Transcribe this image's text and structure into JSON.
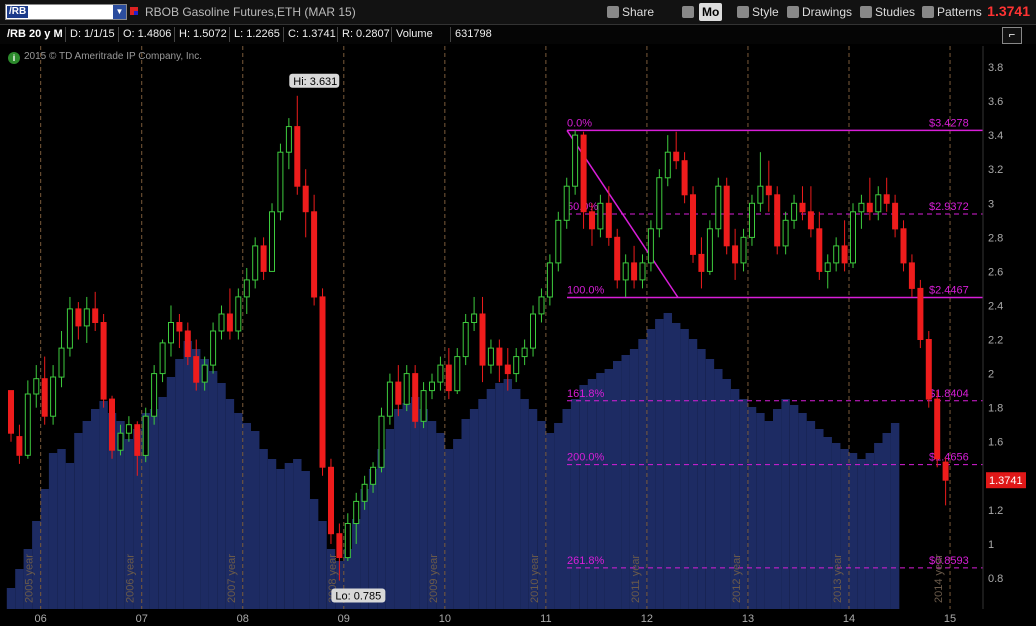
{
  "toolbar": {
    "symbol": "/RB",
    "title": "RBOB Gasoline Futures,ETH (MAR 15)",
    "share": "Share",
    "mode": "Mo",
    "style": "Style",
    "drawings": "Drawings",
    "studies": "Studies",
    "patterns": "Patterns",
    "last_price": "1.3741"
  },
  "info": {
    "period": "/RB 20 y M",
    "date": "D: 1/1/15",
    "open": "O: 1.4806",
    "high": "H: 1.5072",
    "low": "L: 1.2265",
    "close": "C: 1.3741",
    "range": "R: 0.2807",
    "volume_label": "Volume",
    "volume": "631798"
  },
  "copyright": "2015 © TD Ameritrade IP Company, Inc.",
  "chart_data": {
    "type": "candlestick",
    "title": "RBOB Gasoline Futures,ETH (MAR 15)",
    "period": "Monthly",
    "ylim": [
      0.62,
      3.92
    ],
    "y_ticks": [
      0.8,
      1,
      1.2,
      1.4,
      1.6,
      1.8,
      2,
      2.2,
      2.4,
      2.6,
      2.8,
      3,
      3.2,
      3.4,
      3.6,
      3.8
    ],
    "x_tick_labels": [
      "06",
      "07",
      "08",
      "09",
      "10",
      "11",
      "12",
      "13",
      "14",
      "15"
    ],
    "year_labels": [
      "2005 year",
      "2006 year",
      "2007 year",
      "2008 year",
      "2009 year",
      "2010 year",
      "2011 year",
      "2012 year",
      "2013 year",
      "2014 year"
    ],
    "hi_label": "Hi: 3.631",
    "lo_label": "Lo: 0.785",
    "last_price_label": "1.3741",
    "candles": [
      {
        "month": "2005-09",
        "open": 1.9,
        "high": 1.9,
        "low": 1.6,
        "close": 1.65
      },
      {
        "month": "2005-10",
        "open": 1.63,
        "high": 1.7,
        "low": 1.47,
        "close": 1.52
      },
      {
        "month": "2005-11",
        "open": 1.52,
        "high": 1.96,
        "low": 1.5,
        "close": 1.88
      },
      {
        "month": "2005-12",
        "open": 1.88,
        "high": 2.05,
        "low": 1.8,
        "close": 1.97
      },
      {
        "month": "2006-01",
        "open": 1.97,
        "high": 2.1,
        "low": 1.7,
        "close": 1.75
      },
      {
        "month": "2006-02",
        "open": 1.75,
        "high": 2.05,
        "low": 1.7,
        "close": 1.98
      },
      {
        "month": "2006-03",
        "open": 1.98,
        "high": 2.25,
        "low": 1.92,
        "close": 2.15
      },
      {
        "month": "2006-04",
        "open": 2.15,
        "high": 2.45,
        "low": 2.1,
        "close": 2.38
      },
      {
        "month": "2006-05",
        "open": 2.38,
        "high": 2.42,
        "low": 2.2,
        "close": 2.28
      },
      {
        "month": "2006-06",
        "open": 2.28,
        "high": 2.45,
        "low": 2.18,
        "close": 2.38
      },
      {
        "month": "2006-07",
        "open": 2.38,
        "high": 2.48,
        "low": 2.25,
        "close": 2.3
      },
      {
        "month": "2006-08",
        "open": 2.3,
        "high": 2.35,
        "low": 1.8,
        "close": 1.85
      },
      {
        "month": "2006-09",
        "open": 1.85,
        "high": 1.87,
        "low": 1.5,
        "close": 1.55
      },
      {
        "month": "2006-10",
        "open": 1.55,
        "high": 1.7,
        "low": 1.52,
        "close": 1.65
      },
      {
        "month": "2006-11",
        "open": 1.65,
        "high": 1.75,
        "low": 1.6,
        "close": 1.7
      },
      {
        "month": "2006-12",
        "open": 1.7,
        "high": 1.72,
        "low": 1.4,
        "close": 1.52
      },
      {
        "month": "2007-01",
        "open": 1.52,
        "high": 1.8,
        "low": 1.48,
        "close": 1.75
      },
      {
        "month": "2007-02",
        "open": 1.75,
        "high": 2.05,
        "low": 1.7,
        "close": 2.0
      },
      {
        "month": "2007-03",
        "open": 2.0,
        "high": 2.2,
        "low": 1.95,
        "close": 2.18
      },
      {
        "month": "2007-04",
        "open": 2.18,
        "high": 2.4,
        "low": 2.1,
        "close": 2.3
      },
      {
        "month": "2007-05",
        "open": 2.3,
        "high": 2.35,
        "low": 2.15,
        "close": 2.25
      },
      {
        "month": "2007-06",
        "open": 2.25,
        "high": 2.3,
        "low": 2.05,
        "close": 2.1
      },
      {
        "month": "2007-07",
        "open": 2.1,
        "high": 2.2,
        "low": 1.9,
        "close": 1.95
      },
      {
        "month": "2007-08",
        "open": 1.95,
        "high": 2.1,
        "low": 1.9,
        "close": 2.05
      },
      {
        "month": "2007-09",
        "open": 2.05,
        "high": 2.3,
        "low": 2.0,
        "close": 2.25
      },
      {
        "month": "2007-10",
        "open": 2.25,
        "high": 2.4,
        "low": 2.2,
        "close": 2.35
      },
      {
        "month": "2007-11",
        "open": 2.35,
        "high": 2.5,
        "low": 2.2,
        "close": 2.25
      },
      {
        "month": "2007-12",
        "open": 2.25,
        "high": 2.5,
        "low": 2.2,
        "close": 2.45
      },
      {
        "month": "2008-01",
        "open": 2.45,
        "high": 2.62,
        "low": 2.35,
        "close": 2.55
      },
      {
        "month": "2008-02",
        "open": 2.55,
        "high": 2.8,
        "low": 2.5,
        "close": 2.75
      },
      {
        "month": "2008-03",
        "open": 2.75,
        "high": 2.8,
        "low": 2.55,
        "close": 2.6
      },
      {
        "month": "2008-04",
        "open": 2.6,
        "high": 3.0,
        "low": 2.6,
        "close": 2.95
      },
      {
        "month": "2008-05",
        "open": 2.95,
        "high": 3.35,
        "low": 2.9,
        "close": 3.3
      },
      {
        "month": "2008-06",
        "open": 3.3,
        "high": 3.5,
        "low": 3.2,
        "close": 3.45
      },
      {
        "month": "2008-07",
        "open": 3.45,
        "high": 3.631,
        "low": 3.05,
        "close": 3.1
      },
      {
        "month": "2008-08",
        "open": 3.1,
        "high": 3.2,
        "low": 2.8,
        "close": 2.95
      },
      {
        "month": "2008-09",
        "open": 2.95,
        "high": 3.05,
        "low": 2.4,
        "close": 2.45
      },
      {
        "month": "2008-10",
        "open": 2.45,
        "high": 2.5,
        "low": 1.4,
        "close": 1.45
      },
      {
        "month": "2008-11",
        "open": 1.45,
        "high": 1.5,
        "low": 1.0,
        "close": 1.06
      },
      {
        "month": "2008-12",
        "open": 1.06,
        "high": 1.12,
        "low": 0.785,
        "close": 0.92
      },
      {
        "month": "2009-01",
        "open": 0.92,
        "high": 1.18,
        "low": 0.9,
        "close": 1.12
      },
      {
        "month": "2009-02",
        "open": 1.12,
        "high": 1.3,
        "low": 1.0,
        "close": 1.25
      },
      {
        "month": "2009-03",
        "open": 1.25,
        "high": 1.4,
        "low": 1.2,
        "close": 1.35
      },
      {
        "month": "2009-04",
        "open": 1.35,
        "high": 1.48,
        "low": 1.3,
        "close": 1.45
      },
      {
        "month": "2009-05",
        "open": 1.45,
        "high": 1.8,
        "low": 1.42,
        "close": 1.75
      },
      {
        "month": "2009-06",
        "open": 1.75,
        "high": 2.0,
        "low": 1.7,
        "close": 1.95
      },
      {
        "month": "2009-07",
        "open": 1.95,
        "high": 2.05,
        "low": 1.75,
        "close": 1.82
      },
      {
        "month": "2009-08",
        "open": 1.82,
        "high": 2.05,
        "low": 1.78,
        "close": 2.0
      },
      {
        "month": "2009-09",
        "open": 2.0,
        "high": 2.05,
        "low": 1.68,
        "close": 1.72
      },
      {
        "month": "2009-10",
        "open": 1.72,
        "high": 1.95,
        "low": 1.68,
        "close": 1.9
      },
      {
        "month": "2009-11",
        "open": 1.9,
        "high": 2.0,
        "low": 1.85,
        "close": 1.95
      },
      {
        "month": "2009-12",
        "open": 1.95,
        "high": 2.1,
        "low": 1.9,
        "close": 2.05
      },
      {
        "month": "2010-01",
        "open": 2.05,
        "high": 2.15,
        "low": 1.85,
        "close": 1.9
      },
      {
        "month": "2010-02",
        "open": 1.9,
        "high": 2.15,
        "low": 1.88,
        "close": 2.1
      },
      {
        "month": "2010-03",
        "open": 2.1,
        "high": 2.35,
        "low": 2.05,
        "close": 2.3
      },
      {
        "month": "2010-04",
        "open": 2.3,
        "high": 2.45,
        "low": 2.25,
        "close": 2.35
      },
      {
        "month": "2010-05",
        "open": 2.35,
        "high": 2.45,
        "low": 1.95,
        "close": 2.05
      },
      {
        "month": "2010-06",
        "open": 2.05,
        "high": 2.2,
        "low": 2.0,
        "close": 2.15
      },
      {
        "month": "2010-07",
        "open": 2.15,
        "high": 2.2,
        "low": 1.95,
        "close": 2.05
      },
      {
        "month": "2010-08",
        "open": 2.05,
        "high": 2.15,
        "low": 1.9,
        "close": 2.0
      },
      {
        "month": "2010-09",
        "open": 2.0,
        "high": 2.15,
        "low": 1.95,
        "close": 2.1
      },
      {
        "month": "2010-10",
        "open": 2.1,
        "high": 2.2,
        "low": 2.05,
        "close": 2.15
      },
      {
        "month": "2010-11",
        "open": 2.15,
        "high": 2.4,
        "low": 2.1,
        "close": 2.35
      },
      {
        "month": "2010-12",
        "open": 2.35,
        "high": 2.5,
        "low": 2.3,
        "close": 2.45
      },
      {
        "month": "2011-01",
        "open": 2.45,
        "high": 2.7,
        "low": 2.4,
        "close": 2.65
      },
      {
        "month": "2011-02",
        "open": 2.65,
        "high": 2.95,
        "low": 2.6,
        "close": 2.9
      },
      {
        "month": "2011-03",
        "open": 2.9,
        "high": 3.15,
        "low": 2.85,
        "close": 3.1
      },
      {
        "month": "2011-04",
        "open": 3.1,
        "high": 3.4278,
        "low": 3.05,
        "close": 3.4
      },
      {
        "month": "2011-05",
        "open": 3.4,
        "high": 3.42,
        "low": 2.85,
        "close": 2.95
      },
      {
        "month": "2011-06",
        "open": 2.95,
        "high": 3.0,
        "low": 2.75,
        "close": 2.85
      },
      {
        "month": "2011-07",
        "open": 2.85,
        "high": 3.05,
        "low": 2.8,
        "close": 3.0
      },
      {
        "month": "2011-08",
        "open": 3.0,
        "high": 3.1,
        "low": 2.75,
        "close": 2.8
      },
      {
        "month": "2011-09",
        "open": 2.8,
        "high": 2.85,
        "low": 2.5,
        "close": 2.55
      },
      {
        "month": "2011-10",
        "open": 2.55,
        "high": 2.7,
        "low": 2.45,
        "close": 2.65
      },
      {
        "month": "2011-11",
        "open": 2.65,
        "high": 2.75,
        "low": 2.5,
        "close": 2.55
      },
      {
        "month": "2011-12",
        "open": 2.55,
        "high": 2.7,
        "low": 2.5,
        "close": 2.65
      },
      {
        "month": "2012-01",
        "open": 2.65,
        "high": 2.9,
        "low": 2.6,
        "close": 2.85
      },
      {
        "month": "2012-02",
        "open": 2.85,
        "high": 3.2,
        "low": 2.8,
        "close": 3.15
      },
      {
        "month": "2012-03",
        "open": 3.15,
        "high": 3.4,
        "low": 3.1,
        "close": 3.3
      },
      {
        "month": "2012-04",
        "open": 3.3,
        "high": 3.42,
        "low": 3.2,
        "close": 3.25
      },
      {
        "month": "2012-05",
        "open": 3.25,
        "high": 3.3,
        "low": 3.0,
        "close": 3.05
      },
      {
        "month": "2012-06",
        "open": 3.05,
        "high": 3.1,
        "low": 2.65,
        "close": 2.7
      },
      {
        "month": "2012-07",
        "open": 2.7,
        "high": 2.8,
        "low": 2.5,
        "close": 2.6
      },
      {
        "month": "2012-08",
        "open": 2.6,
        "high": 2.9,
        "low": 2.58,
        "close": 2.85
      },
      {
        "month": "2012-09",
        "open": 2.85,
        "high": 3.15,
        "low": 2.8,
        "close": 3.1
      },
      {
        "month": "2012-10",
        "open": 3.1,
        "high": 3.15,
        "low": 2.7,
        "close": 2.75
      },
      {
        "month": "2012-11",
        "open": 2.75,
        "high": 2.85,
        "low": 2.55,
        "close": 2.65
      },
      {
        "month": "2012-12",
        "open": 2.65,
        "high": 2.85,
        "low": 2.6,
        "close": 2.8
      },
      {
        "month": "2013-01",
        "open": 2.8,
        "high": 3.05,
        "low": 2.75,
        "close": 3.0
      },
      {
        "month": "2013-02",
        "open": 3.0,
        "high": 3.3,
        "low": 2.95,
        "close": 3.1
      },
      {
        "month": "2013-03",
        "open": 3.1,
        "high": 3.25,
        "low": 2.95,
        "close": 3.05
      },
      {
        "month": "2013-04",
        "open": 3.05,
        "high": 3.1,
        "low": 2.7,
        "close": 2.75
      },
      {
        "month": "2013-05",
        "open": 2.75,
        "high": 2.95,
        "low": 2.7,
        "close": 2.9
      },
      {
        "month": "2013-06",
        "open": 2.9,
        "high": 3.05,
        "low": 2.85,
        "close": 3.0
      },
      {
        "month": "2013-07",
        "open": 3.0,
        "high": 3.1,
        "low": 2.9,
        "close": 2.95
      },
      {
        "month": "2013-08",
        "open": 2.95,
        "high": 3.1,
        "low": 2.8,
        "close": 2.85
      },
      {
        "month": "2013-09",
        "open": 2.85,
        "high": 2.95,
        "low": 2.55,
        "close": 2.6
      },
      {
        "month": "2013-10",
        "open": 2.6,
        "high": 2.7,
        "low": 2.5,
        "close": 2.65
      },
      {
        "month": "2013-11",
        "open": 2.65,
        "high": 2.8,
        "low": 2.6,
        "close": 2.75
      },
      {
        "month": "2013-12",
        "open": 2.75,
        "high": 2.9,
        "low": 2.6,
        "close": 2.65
      },
      {
        "month": "2014-01",
        "open": 2.65,
        "high": 3.0,
        "low": 2.62,
        "close": 2.95
      },
      {
        "month": "2014-02",
        "open": 2.95,
        "high": 3.05,
        "low": 2.85,
        "close": 3.0
      },
      {
        "month": "2014-03",
        "open": 3.0,
        "high": 3.15,
        "low": 2.9,
        "close": 2.95
      },
      {
        "month": "2014-04",
        "open": 2.95,
        "high": 3.1,
        "low": 2.9,
        "close": 3.05
      },
      {
        "month": "2014-05",
        "open": 3.05,
        "high": 3.15,
        "low": 2.95,
        "close": 3.0
      },
      {
        "month": "2014-06",
        "open": 3.0,
        "high": 3.05,
        "low": 2.8,
        "close": 2.85
      },
      {
        "month": "2014-07",
        "open": 2.85,
        "high": 2.9,
        "low": 2.6,
        "close": 2.65
      },
      {
        "month": "2014-08",
        "open": 2.65,
        "high": 2.7,
        "low": 2.45,
        "close": 2.5
      },
      {
        "month": "2014-09",
        "open": 2.5,
        "high": 2.55,
        "low": 2.15,
        "close": 2.2
      },
      {
        "month": "2014-10",
        "open": 2.2,
        "high": 2.25,
        "low": 1.8,
        "close": 1.85
      },
      {
        "month": "2014-11",
        "open": 1.85,
        "high": 1.9,
        "low": 1.45,
        "close": 1.5
      },
      {
        "month": "2014-12",
        "open": 1.4806,
        "high": 1.5072,
        "low": 1.2265,
        "close": 1.3741
      }
    ],
    "volume_series": [
      21,
      40,
      60,
      88,
      120,
      156,
      160,
      146,
      176,
      188,
      200,
      208,
      196,
      188,
      170,
      180,
      196,
      200,
      212,
      232,
      250,
      268,
      260,
      250,
      238,
      226,
      210,
      196,
      186,
      178,
      160,
      150,
      140,
      146,
      150,
      138,
      110,
      88,
      60,
      48,
      60,
      90,
      120,
      140,
      160,
      180,
      200,
      206,
      212,
      200,
      188,
      176,
      160,
      170,
      190,
      200,
      210,
      220,
      226,
      230,
      220,
      210,
      200,
      188,
      176,
      186,
      200,
      210,
      224,
      230,
      236,
      240,
      248,
      254,
      260,
      270,
      280,
      290,
      296,
      286,
      280,
      270,
      260,
      250,
      240,
      230,
      220,
      210,
      202,
      196,
      188,
      200,
      210,
      204,
      196,
      188,
      180,
      172,
      166,
      160,
      156,
      150,
      156,
      166,
      176,
      186
    ],
    "fibonacci": [
      {
        "label": "0.0%",
        "value": 3.4278,
        "value_label": "$3.4278"
      },
      {
        "label": "50.0%",
        "value": 2.9372,
        "value_label": "$2.9372"
      },
      {
        "label": "100.0%",
        "value": 2.4467,
        "value_label": "$2.4467"
      },
      {
        "label": "161.8%",
        "value": 1.8404,
        "value_label": "$1.8404"
      },
      {
        "label": "200.0%",
        "value": 1.4656,
        "value_label": "$1.4656"
      },
      {
        "label": "261.8%",
        "value": 0.8593,
        "value_label": "$0.8593"
      }
    ],
    "colors": {
      "up": "#3ecc3e",
      "down": "#ee1c1c",
      "volume": "#1d2b63",
      "fib": "#d81ed8",
      "grid": "#7a5a3a",
      "axis_text": "#aaaaaa"
    }
  }
}
